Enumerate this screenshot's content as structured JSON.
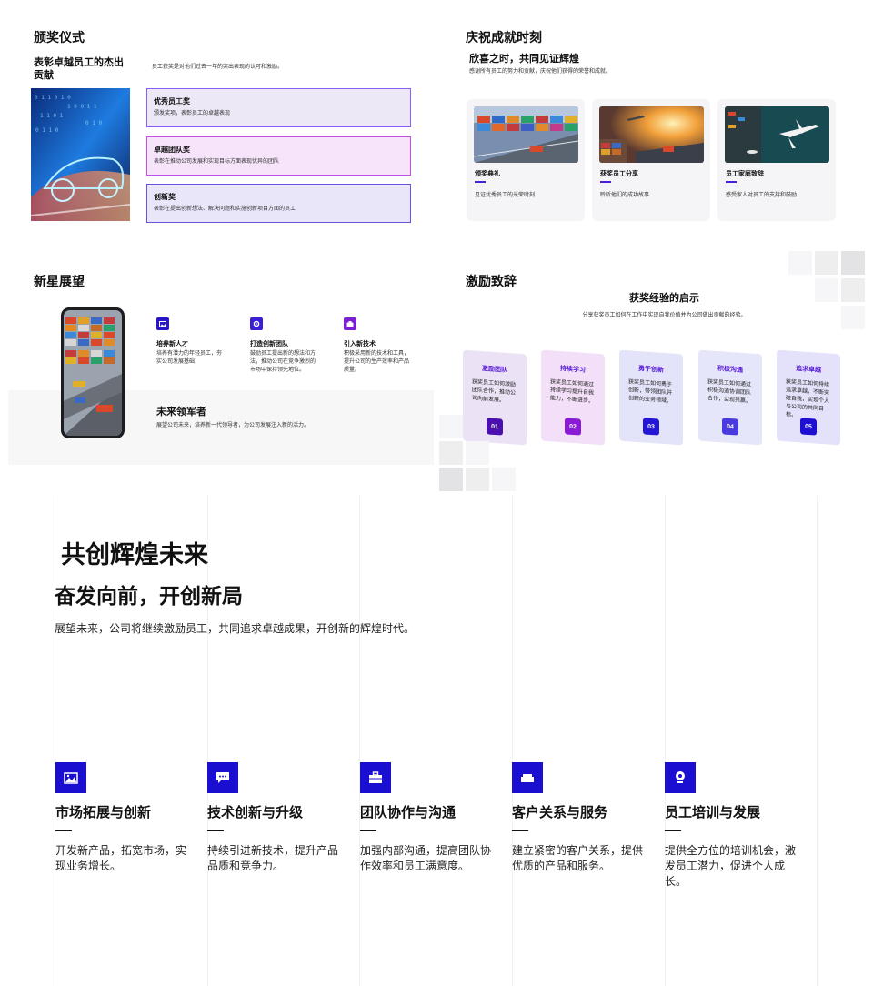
{
  "panel1": {
    "section_title": "颁奖仪式",
    "heading": "表彰卓越员工的杰出贡献",
    "intro": "员工获奖是对他们过去一年的突出表现的认可和激励。",
    "awards": [
      {
        "title": "优秀员工奖",
        "desc": "颁发奖项，表彰员工的卓越表现",
        "bg": "#ede8f5"
      },
      {
        "title": "卓越团队奖",
        "desc": "表彰在推动公司发展和实现目标方面表现优异的团队",
        "bg": "#f7e4fb"
      },
      {
        "title": "创新奖",
        "desc": "表彰在提出创新想法、解决问题和实施创新项目方面的员工",
        "bg": "#e9e6fa"
      }
    ]
  },
  "panel2": {
    "section_title": "庆祝成就时刻",
    "heading": "欣喜之时，共同见证辉煌",
    "intro": "感谢所有员工的努力和贡献，庆祝他们获得的荣誉和成就。",
    "cards": [
      {
        "title": "颁奖典礼",
        "desc": "见证优秀员工的光荣时刻"
      },
      {
        "title": "获奖员工分享",
        "desc": "聆听他们的成功故事"
      },
      {
        "title": "员工家庭致辞",
        "desc": "感受家人对员工的支持和鼓励"
      }
    ]
  },
  "panel3": {
    "section_title": "新星展望",
    "features": [
      {
        "title": "培养新人才",
        "desc": "培养有潜力的年轻员工，夯实公司发展基础",
        "icon": "image-icon",
        "color": "#2a16c9"
      },
      {
        "title": "打造创新团队",
        "desc": "鼓励员工提出新的想法和方法，推动公司在竞争激烈的市场中保持领先地位。",
        "icon": "gear-icon",
        "color": "#3a1fd6"
      },
      {
        "title": "引入新技术",
        "desc": "积极采用新的技术和工具，提升公司的生产效率和产品质量。",
        "icon": "chip-icon",
        "color": "#7a1fd6"
      }
    ],
    "leader_title": "未来领军者",
    "leader_desc": "展望公司未来，培养新一代领导者，为公司发展注入新的活力。"
  },
  "panel4": {
    "section_title": "激励致辞",
    "heading": "获奖经验的启示",
    "intro": "分享获奖员工如何在工作中实现自我价值并为公司做出贡献的经验。",
    "items": [
      {
        "title": "激励团队",
        "desc": "获奖员工如何激励团队合作，推动公司向前发展。",
        "num": "01",
        "bg": "#ece2f6",
        "numColor": "#4b0fb0"
      },
      {
        "title": "持续学习",
        "desc": "获奖员工如何通过持续学习提升自我能力，不断进步。",
        "num": "02",
        "bg": "#f3dff8",
        "numColor": "#8a1ad6"
      },
      {
        "title": "勇于创新",
        "desc": "获奖员工如何勇于创新，带领团队开创新的业务领域。",
        "num": "03",
        "bg": "#e3e3fa",
        "numColor": "#2416d6"
      },
      {
        "title": "积极沟通",
        "desc": "获奖员工如何通过积极沟通协调团队合作，实现共赢。",
        "num": "04",
        "bg": "#e6e6fb",
        "numColor": "#4a3be0"
      },
      {
        "title": "追求卓越",
        "desc": "获奖员工如何持续追求卓越，不断突破自我，实现个人与公司的共同目标。",
        "num": "05",
        "bg": "#e3e2fa",
        "numColor": "#1d10d0"
      }
    ]
  },
  "panel5": {
    "title": "共创辉煌未来",
    "subtitle": "奋发向前，开创新局",
    "desc": "展望未来，公司将继续激励员工，共同追求卓越成果，开创新的辉煌时代。",
    "columns": [
      {
        "title": "市场拓展与创新",
        "desc": "开发新产品，拓宽市场，实现业务增长。",
        "icon": "image-icon"
      },
      {
        "title": "技术创新与升级",
        "desc": "持续引进新技术，提升产品品质和竞争力。",
        "icon": "chat-icon"
      },
      {
        "title": "团队协作与沟通",
        "desc": "加强内部沟通，提高团队协作效率和员工满意度。",
        "icon": "briefcase-icon"
      },
      {
        "title": "客户关系与服务",
        "desc": "建立紧密的客户关系，提供优质的产品和服务。",
        "icon": "sofa-icon"
      },
      {
        "title": "员工培训与发展",
        "desc": "提供全方位的培训机会，激发员工潜力，促进个人成长。",
        "icon": "location-icon"
      }
    ]
  }
}
